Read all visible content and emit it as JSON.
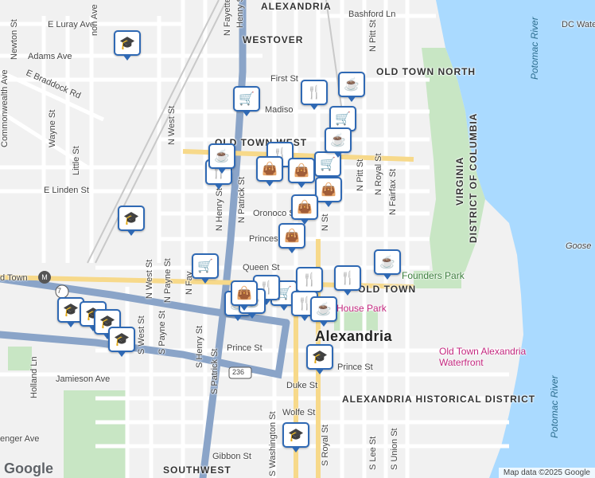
{
  "map": {
    "neighborhoods": [
      "ALEXANDRIA",
      "WESTOVER",
      "OLD TOWN NORTH",
      "OLD TOWN WEST",
      "OLD TOWN",
      "ALEXANDRIA HISTORICAL DISTRICT",
      "SOUTHWEST"
    ],
    "city_label": "Alexandria",
    "region_labels": [
      "DC Water",
      "VIRGINIA",
      "DISTRICT OF COLUMBIA"
    ],
    "water_labels": [
      "Potomac River",
      "Potomac River"
    ],
    "place_labels": [
      "Goose",
      "Founders Park",
      "House Park",
      "Old Town Alexandria Waterfront",
      "d Town"
    ],
    "streets": {
      "luray": "E Luray Ave",
      "adams": "Adams Ave",
      "braddock": "E Braddock Rd",
      "newton": "Newton St",
      "commonwealth": "Commonwealth Ave",
      "wayne": "Wayne St",
      "little": "Little St",
      "linden": "E Linden St",
      "west": "N West St",
      "fayette_n": "N Fayette St",
      "henry_n": "N Henry St",
      "patrick_n": "N Patrick St",
      "first": "First St",
      "madison": "Madiso",
      "oronoco": "Oronoco S",
      "princess": "Princes",
      "queen": "Queen St",
      "bashford": "Bashford Ln",
      "pitt": "N Pitt St",
      "royal_n": "N Royal St",
      "fairfax_n": "N Fairfax St",
      "st_asaph": "N St",
      "west_s": "S West St",
      "payne_s": "S Payne St",
      "payne_n": "N Payne St",
      "west_n2": "N West St",
      "fayette2": "N Fay",
      "henry_s": "S Henry St",
      "patrick_s": "S Patrick St",
      "prince": "Prince St",
      "jamieson": "Jamieson Ave",
      "holland": "Holland Ln",
      "duke": "Duke St",
      "wolfe": "Wolfe St",
      "gibbon": "Gibbon St",
      "washington_s": "S Washington St",
      "royal_s": "S Royal St",
      "lee_s": "S Lee St",
      "union_s": "S Union St",
      "prince2": "Prince St",
      "enger": "enger Ave",
      "henry_top": "Henry St",
      "fayette_top": "N Fayette St",
      "non": "non Ave",
      "n_royal": "N Royal St",
      "route": "236",
      "route2": "7",
      "mun": "M"
    },
    "google_logo": "Google",
    "attribution": "Map data ©2025 Google"
  },
  "markers": [
    {
      "icon": "school",
      "glyph": "🎓"
    },
    {
      "icon": "school",
      "glyph": "🎓"
    },
    {
      "icon": "school",
      "glyph": "🎓"
    },
    {
      "icon": "school",
      "glyph": "🎓"
    },
    {
      "icon": "school",
      "glyph": "🎓"
    },
    {
      "icon": "school",
      "glyph": "🎓"
    },
    {
      "icon": "school",
      "glyph": "🎓"
    },
    {
      "icon": "school",
      "glyph": "🎓"
    },
    {
      "icon": "shopping-cart",
      "glyph": "🛒"
    },
    {
      "icon": "shopping-cart",
      "glyph": "🛒"
    },
    {
      "icon": "shopping-cart",
      "glyph": "🛒"
    },
    {
      "icon": "shopping-cart",
      "glyph": "🛒"
    },
    {
      "icon": "shopping-cart",
      "glyph": "🛒"
    },
    {
      "icon": "restaurant",
      "glyph": "🍴"
    },
    {
      "icon": "restaurant",
      "glyph": "🍴"
    },
    {
      "icon": "restaurant",
      "glyph": "🍴"
    },
    {
      "icon": "restaurant",
      "glyph": "🍴"
    },
    {
      "icon": "restaurant",
      "glyph": "🍴"
    },
    {
      "icon": "restaurant",
      "glyph": "🍴"
    },
    {
      "icon": "restaurant",
      "glyph": "🍴"
    },
    {
      "icon": "coffee",
      "glyph": "☕"
    },
    {
      "icon": "coffee",
      "glyph": "☕"
    },
    {
      "icon": "coffee",
      "glyph": "☕"
    },
    {
      "icon": "coffee",
      "glyph": "☕"
    },
    {
      "icon": "coffee",
      "glyph": "☕"
    },
    {
      "icon": "coffee",
      "glyph": "☕"
    },
    {
      "icon": "coffee",
      "glyph": "☕"
    },
    {
      "icon": "shopping-bag",
      "glyph": "👜"
    },
    {
      "icon": "shopping-bag",
      "glyph": "👜"
    },
    {
      "icon": "shopping-bag",
      "glyph": "👜"
    },
    {
      "icon": "shopping-bag",
      "glyph": "👜"
    },
    {
      "icon": "shopping-bag",
      "glyph": "👜"
    },
    {
      "icon": "shopping-bag",
      "glyph": "👜"
    }
  ],
  "colors": {
    "water": "#aadaff",
    "park": "#c8e6c4",
    "road_major": "#8aa4c8",
    "marker_border": "#2f69b4",
    "bg": "#f1f1f1"
  }
}
